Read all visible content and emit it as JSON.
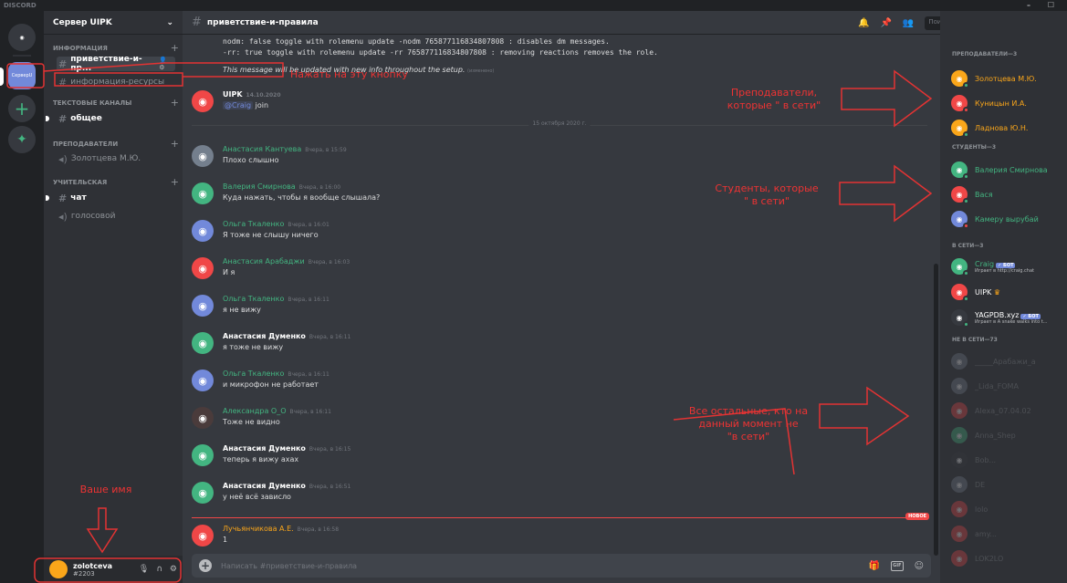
{
  "window": {
    "title": "DISCORD",
    "controls": "– ☐"
  },
  "rail": {
    "uipk_label": "СерверU"
  },
  "server": {
    "name": "Сервер UIPK"
  },
  "categories": {
    "info": "ИНФОРМАЦИЯ",
    "text": "ТЕКСТОВЫЕ КАНАЛЫ",
    "teachers": "ПРЕПОДАВАТЕЛИ",
    "teacherroom": "УЧИТЕЛЬСКАЯ"
  },
  "channels": {
    "welcome": "приветствие-и-пр...",
    "resources": "информация-ресурсы",
    "general": "общее",
    "teacher_voice_user": "Золотцева М.Ю.",
    "chat": "чат",
    "voice": "голосовой"
  },
  "user": {
    "name": "zolotceva",
    "tag": "#2203"
  },
  "header": {
    "channel": "приветствие-и-правила",
    "search_placeholder": "Поиск"
  },
  "system": {
    "line1": "nodm: false toggle with rolemenu update -nodm 765877116834807808 : disables dm messages.",
    "line2": "-rr: true toggle with rolemenu update -rr 765877116834807808 : removing reactions removes the role.",
    "note": "This message will be updated with new info throughout the setup.",
    "edited": "(изменено)"
  },
  "date_divider": "15 октября 2020 г.",
  "new_label": "НОВОЕ",
  "messages": [
    {
      "author": "UIPK",
      "ts": "14.10.2020",
      "mention": "@Craig",
      "text": " join",
      "color": "#ffffff"
    },
    {
      "author": "Анастасия Кантуева",
      "ts": "Вчера, в 15:59",
      "text": "Плохо слышно",
      "color": "#43b581"
    },
    {
      "author": "Валерия Смирнова",
      "ts": "Вчера, в 16:00",
      "text": "Куда нажать, чтобы я вообще слышала?",
      "color": "#43b581"
    },
    {
      "author": "Ольга Ткаленко",
      "ts": "Вчера, в 16:01",
      "text": "Я тоже не слышу ничего",
      "color": "#43b581"
    },
    {
      "author": "Анастасия Арабаджи",
      "ts": "Вчера, в 16:03",
      "text": "И я",
      "color": "#43b581"
    },
    {
      "author": "Ольга Ткаленко",
      "ts": "Вчера, в 16:11",
      "text": "я не вижу",
      "color": "#43b581"
    },
    {
      "author": "Анастасия Думенко",
      "ts": "Вчера, в 16:11",
      "text": "я тоже не вижу",
      "color": "#ffffff"
    },
    {
      "author": "Ольга Ткаленко",
      "ts": "Вчера, в 16:11",
      "text": "и микрофон не работает",
      "color": "#43b581"
    },
    {
      "author": "Александра О_О",
      "ts": "Вчера, в 16:11",
      "text": "Тоже не видно",
      "color": "#43b581"
    },
    {
      "author": "Анастасия Думенко",
      "ts": "Вчера, в 16:15",
      "text": "теперь я вижу ахах",
      "color": "#ffffff"
    },
    {
      "author": "Анастасия Думенко",
      "ts": "Вчера, в 16:51",
      "text": "у неё всё зависло",
      "color": "#ffffff"
    },
    {
      "author": "Лучьянчикова А.Е.",
      "ts": "Вчера, в 16:58",
      "text": "1",
      "color": "#faa61a"
    }
  ],
  "composer": {
    "placeholder": "Написать #приветствие-и-правила"
  },
  "members": {
    "cat_teachers": "ПРЕПОДАВАТЕЛИ—3",
    "cat_students": "СТУДЕНТЫ—3",
    "cat_online": "В СЕТИ—3",
    "cat_offline": "НЕ В СЕТИ—73",
    "teachers": [
      "Золотцева М.Ю.",
      "Куницын И.А.",
      "Ладнова Ю.Н."
    ],
    "students": [
      "Валерия Смирнова",
      "Вася",
      "Камеру вырубай"
    ],
    "online": [
      {
        "name": "Craig",
        "sub": "Играет в http://craig.chat",
        "bot": "✓ БОТ"
      },
      {
        "name": "UIPK",
        "sub": "",
        "bot": ""
      },
      {
        "name": "YAGPDB.xyz",
        "sub": "Играет в A snake walks into t...",
        "bot": "✓ БОТ"
      }
    ],
    "offline": [
      "_____Арабажи_a",
      "_Lida_FOMA",
      "Alexa_07.04.02",
      "Anna_Shep",
      "Bob...",
      "DE",
      "lolo",
      "amy...",
      "LOK2LO",
      "..."
    ]
  },
  "annotations": {
    "press_button": "Нажать на эту кнопку",
    "teachers_online": "Преподаватели,\nкоторые \" в сети\"",
    "students_online": "Студенты, которые\n\" в сети\"",
    "everyone_else": "Все остальные, кто на\nданный момент не\n\"в сети\"",
    "your_name": "Ваше имя"
  },
  "colors": {
    "annotation": "#e33333",
    "online": "#43b581",
    "dnd": "#f04747",
    "blurple": "#7289da"
  }
}
